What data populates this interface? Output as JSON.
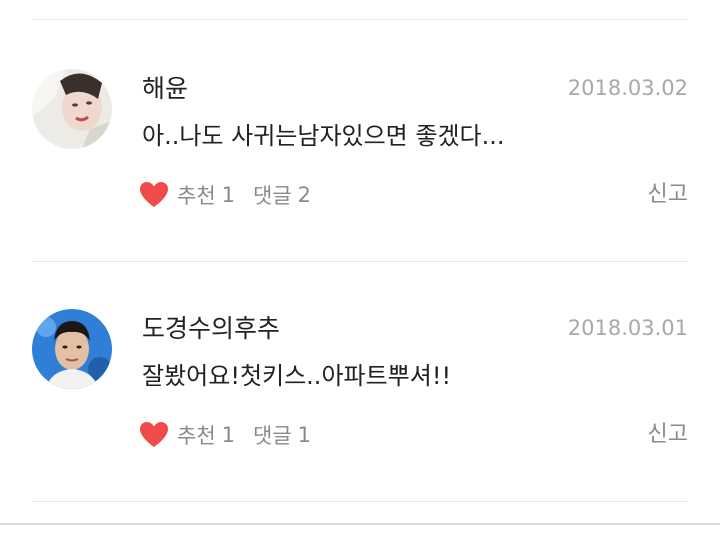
{
  "comments": [
    {
      "author": "해윤",
      "date": "2018.03.02",
      "text": "아..나도 사귀는남자있으면 좋겠다...",
      "like_label": "추천",
      "like_count": "1",
      "reply_label": "댓글",
      "reply_count": "2",
      "report_label": "신고",
      "avatar_icon": "profile-photo-avatar"
    },
    {
      "author": "도경수의후추",
      "date": "2018.03.01",
      "text": "잘봤어요!첫키스..아파트뿌셔!!",
      "like_label": "추천",
      "like_count": "1",
      "reply_label": "댓글",
      "reply_count": "1",
      "report_label": "신고",
      "avatar_icon": "profile-photo-avatar"
    }
  ],
  "colors": {
    "heart": "#f04a4a",
    "text_primary": "#222222",
    "text_secondary": "#8a8a8a",
    "date": "#a8a8a8",
    "divider": "#e6e6e6"
  }
}
